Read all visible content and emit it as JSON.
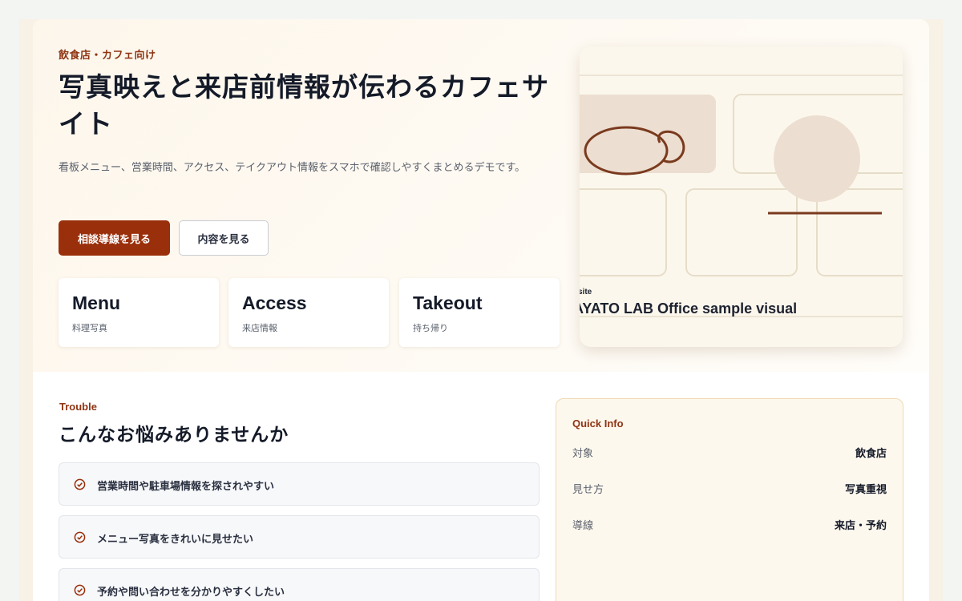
{
  "hero": {
    "eyebrow": "飲食店・カフェ向け",
    "title": "写真映えと来店前情報が伝わるカフェサイト",
    "description": "看板メニュー、営業時間、アクセス、テイクアウト情報をスマホで確認しやすくまとめるデモです。",
    "primary_button": "相談導線を見る",
    "secondary_button": "内容を見る"
  },
  "features": [
    {
      "title": "Menu",
      "subtitle": "料理写真"
    },
    {
      "title": "Access",
      "subtitle": "来店情報"
    },
    {
      "title": "Takeout",
      "subtitle": "持ち帰り"
    }
  ],
  "visual": {
    "small_label": "site",
    "caption": "AYATO LAB Office sample visual"
  },
  "trouble": {
    "eyebrow": "Trouble",
    "title": "こんなお悩みありませんか",
    "items": [
      "営業時間や駐車場情報を探されやすい",
      "メニュー写真をきれいに見せたい",
      "予約や問い合わせを分かりやすくしたい"
    ]
  },
  "quick_info": {
    "title": "Quick Info",
    "rows": [
      {
        "key": "対象",
        "value": "飲食店"
      },
      {
        "key": "見せ方",
        "value": "写真重視"
      },
      {
        "key": "導線",
        "value": "来店・予約"
      }
    ]
  },
  "colors": {
    "accent": "#9a2f0b",
    "eyebrow": "#8f3413",
    "visual_stroke": "#7a3a1e",
    "quick_info_border": "#efd9b3"
  },
  "icons": {
    "trouble_item": "check-circle-icon"
  }
}
